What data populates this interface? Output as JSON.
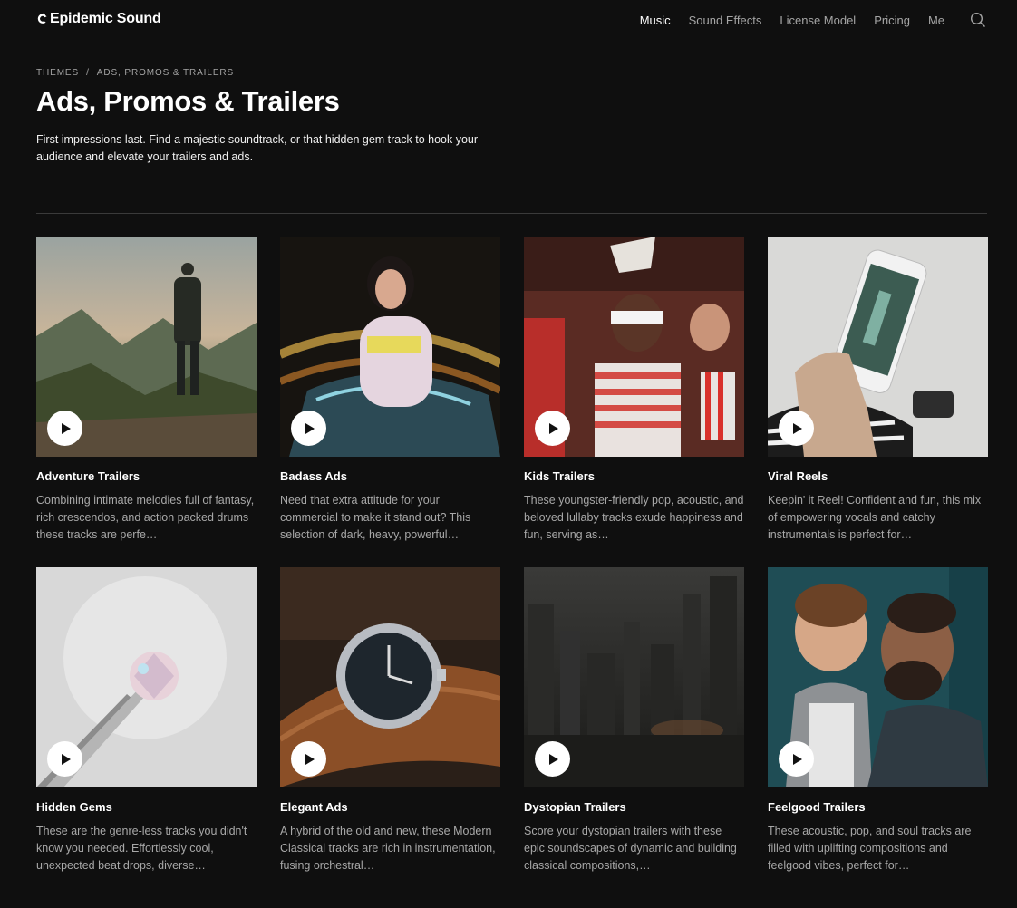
{
  "brand": {
    "name": "Epidemic Sound"
  },
  "nav": {
    "items": [
      {
        "label": "Music",
        "active": true
      },
      {
        "label": "Sound Effects",
        "active": false
      },
      {
        "label": "License Model",
        "active": false
      },
      {
        "label": "Pricing",
        "active": false
      },
      {
        "label": "Me",
        "active": false
      }
    ],
    "search_icon": "search-icon"
  },
  "breadcrumb": {
    "items": [
      "THEMES",
      "ADS, PROMOS & TRAILERS"
    ],
    "separator": "/"
  },
  "page": {
    "title": "Ads, Promos & Trailers",
    "intro": "First impressions last. Find a majestic soundtrack, or that hidden gem track to hook your audience and elevate your trailers and ads."
  },
  "cards": [
    {
      "title": "Adventure Trailers",
      "desc": "Combining intimate melodies full of fantasy, rich crescendos, and action packed drums these tracks are perfe…"
    },
    {
      "title": "Badass Ads",
      "desc": "Need that extra attitude for your commercial to make it stand out? This selection of dark, heavy, powerful…"
    },
    {
      "title": "Kids Trailers",
      "desc": "These youngster-friendly pop, acoustic, and beloved lullaby tracks exude happiness and fun, serving as…"
    },
    {
      "title": "Viral Reels",
      "desc": "Keepin' it Reel! Confident and fun, this mix of empowering vocals and catchy instrumentals is perfect for…"
    },
    {
      "title": "Hidden Gems",
      "desc": "These are the genre-less tracks you didn't know you needed. Effortlessly cool, unexpected beat drops, diverse…"
    },
    {
      "title": "Elegant Ads",
      "desc": "A hybrid of the old and new, these Modern Classical tracks are rich in instrumentation, fusing orchestral…"
    },
    {
      "title": "Dystopian Trailers",
      "desc": "Score your dystopian trailers with these epic soundscapes of dynamic and building classical compositions,…"
    },
    {
      "title": "Feelgood Trailers",
      "desc": "These acoustic, pop, and soul tracks are filled with uplifting compositions and feelgood vibes, perfect for…"
    }
  ],
  "colors": {
    "background": "#0f0f0f",
    "muted_text": "#a5a5a5",
    "divider": "#3a3a3a"
  }
}
